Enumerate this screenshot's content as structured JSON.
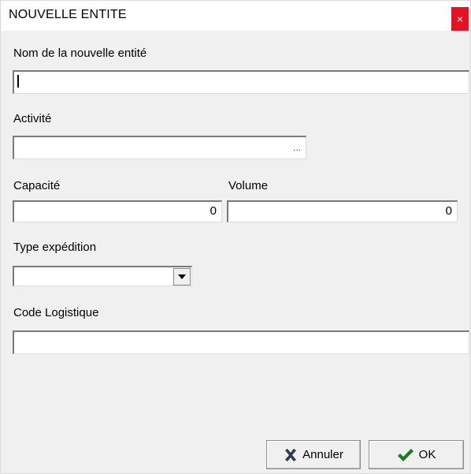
{
  "window": {
    "title": "NOUVELLE ENTITE",
    "close_glyph": "×"
  },
  "form": {
    "nom": {
      "label": "Nom de la nouvelle entité",
      "value": ""
    },
    "activite": {
      "label": "Activité",
      "value": "",
      "browse_glyph": "..."
    },
    "capacite": {
      "label": "Capacité",
      "value": "0"
    },
    "volume": {
      "label": "Volume",
      "value": "0"
    },
    "type_expedition": {
      "label": "Type expédition",
      "selected": ""
    },
    "code_logistique": {
      "label": "Code Logistique",
      "value": ""
    }
  },
  "buttons": {
    "annuler": {
      "label": "Annuler",
      "icon": "x-icon",
      "icon_color": "#2b3a4d"
    },
    "ok": {
      "label": "OK",
      "icon": "check-icon",
      "icon_color": "#1d7a1d"
    }
  }
}
